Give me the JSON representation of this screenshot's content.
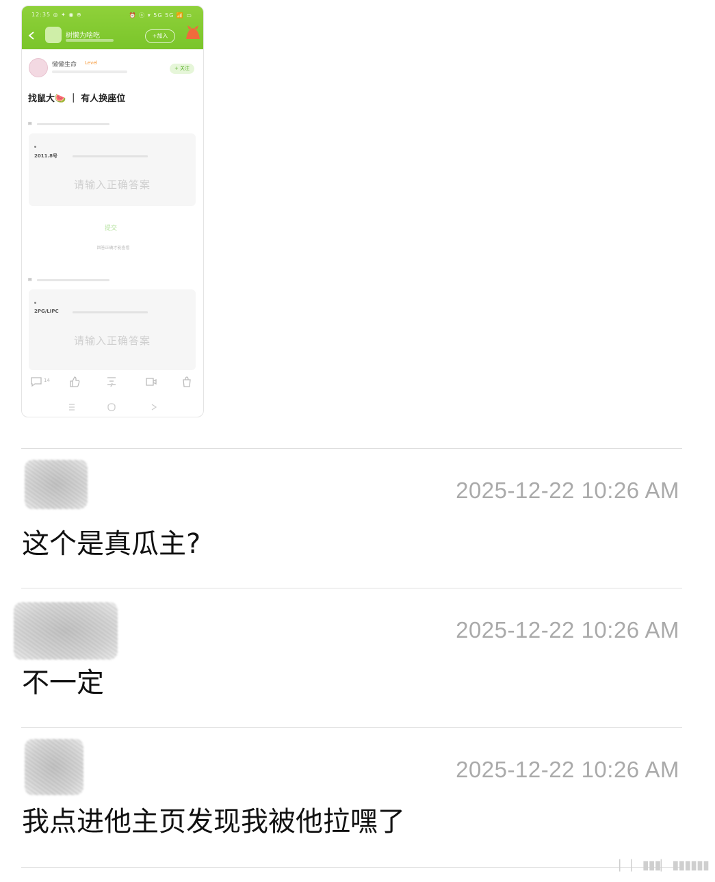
{
  "screenshot": {
    "status_left": "12:35 ◎ ✦ ◉ ⊕",
    "status_right": "⏰ ⓝ ▾ 5G 5G 📶 ▭",
    "group_name": "树懒为啥吃",
    "join_label": "+加入",
    "user_name": "懒懒生命",
    "user_tag": "Level",
    "follow_label": "+ 关注",
    "post_title": "找鼠大🍉 ｜ 有人换座位",
    "q1_label": "2011.8号",
    "q1_placeholder": "请输入正确答案",
    "submit_label": "提交",
    "submit_note": "回答正确才能查看",
    "q2_label": "2PG/LIPC",
    "q2_placeholder": "请输入正确答案",
    "comment_count": "14",
    "icons": [
      "back-icon",
      "comment-icon",
      "like-icon",
      "share-icon",
      "video-icon",
      "bag-icon",
      "menu-icon",
      "home-icon",
      "return-icon"
    ]
  },
  "messages": [
    {
      "timestamp": "2025-12-22 10:26 AM",
      "text": "这个是真瓜主?"
    },
    {
      "timestamp": "2025-12-22 10:26 AM",
      "text": "不一定"
    },
    {
      "timestamp": "2025-12-22 10:26 AM",
      "text": "我点进他主页发现我被他拉嘿了"
    }
  ],
  "watermark": "⎸⎸▮▮▮⎸▮▮▮▮▮▮"
}
